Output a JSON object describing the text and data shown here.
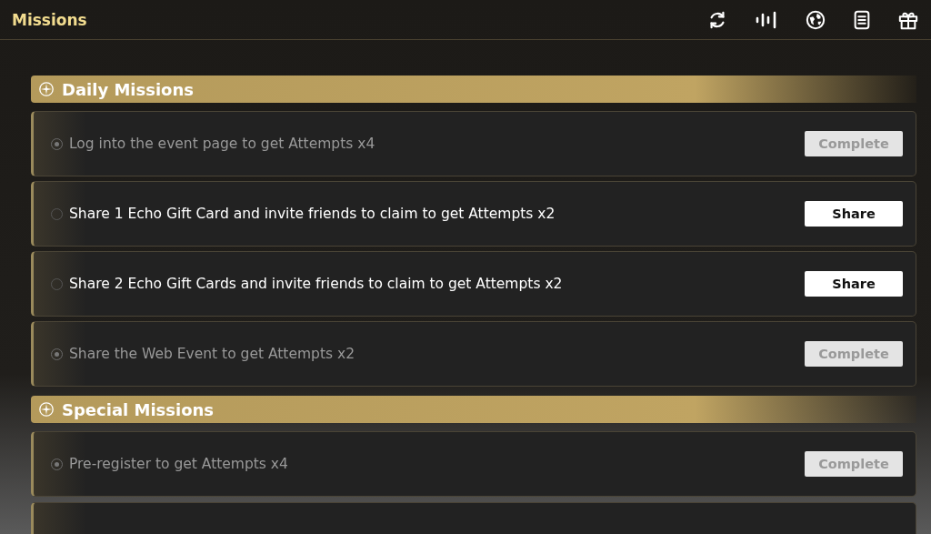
{
  "header": {
    "title": "Missions"
  },
  "sections": [
    {
      "title": "Daily Missions",
      "missions": [
        {
          "text": "Log into the event page to get Attempts x4",
          "completed": true,
          "button": "Complete"
        },
        {
          "text": "Share 1 Echo Gift Card and invite friends to claim to get Attempts x2",
          "completed": false,
          "button": "Share"
        },
        {
          "text": "Share 2 Echo Gift Cards and invite friends to claim to get Attempts x2",
          "completed": false,
          "button": "Share"
        },
        {
          "text": "Share the Web Event to get Attempts x2",
          "completed": true,
          "button": "Complete"
        }
      ]
    },
    {
      "title": "Special Missions",
      "missions": [
        {
          "text": "Pre-register to get Attempts x4",
          "completed": true,
          "button": "Complete"
        }
      ]
    }
  ]
}
